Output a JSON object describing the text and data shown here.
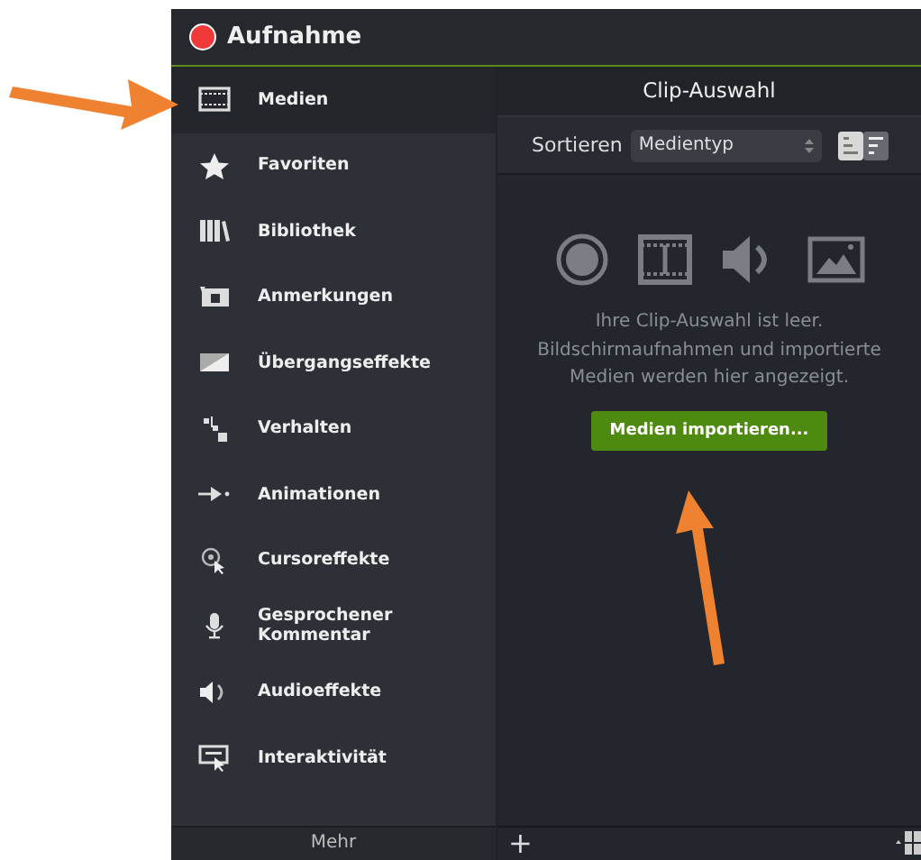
{
  "window": {
    "title": "Aufnahme"
  },
  "sidebar": {
    "items": [
      {
        "kind": "film",
        "label": "Medien",
        "selected": true
      },
      {
        "kind": "star",
        "label": "Favoriten",
        "selected": false
      },
      {
        "kind": "books",
        "label": "Bibliothek",
        "selected": false
      },
      {
        "kind": "callout",
        "label": "Anmerkungen",
        "selected": false
      },
      {
        "kind": "transition",
        "label": "Übergangseffekte",
        "selected": false
      },
      {
        "kind": "behavior",
        "label": "Verhalten",
        "selected": false
      },
      {
        "kind": "animation",
        "label": "Animationen",
        "selected": false
      },
      {
        "kind": "cursor",
        "label": "Cursoreffekte",
        "selected": false
      },
      {
        "kind": "mic",
        "label": "Gesprochener Kommentar",
        "selected": false
      },
      {
        "kind": "audio",
        "label": "Audioeffekte",
        "selected": false
      },
      {
        "kind": "interactive",
        "label": "Interaktivität",
        "selected": false
      }
    ],
    "more": "Mehr"
  },
  "panel": {
    "title": "Clip-Auswahl",
    "sort_label": "Sortieren",
    "sort_value": "Medientyp",
    "empty_text": "Ihre Clip-Auswahl ist leer. Bildschirmaufnahmen und importierte Medien werden hier angezeigt.",
    "import_button": "Medien importieren...",
    "add": "+"
  }
}
